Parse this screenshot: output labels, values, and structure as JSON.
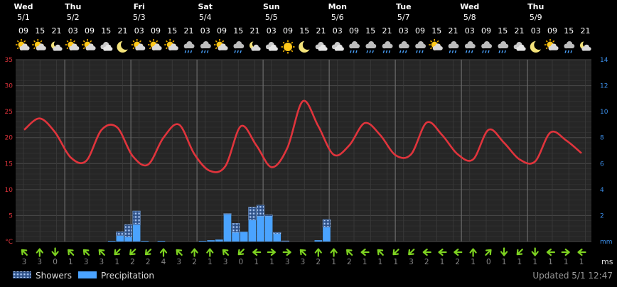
{
  "chart_data": {
    "type": "line",
    "days": [
      {
        "name": "Wed",
        "date": "5/1"
      },
      {
        "name": "Thu",
        "date": "5/2"
      },
      {
        "name": "Fri",
        "date": "5/3"
      },
      {
        "name": "Sat",
        "date": "5/4"
      },
      {
        "name": "Sun",
        "date": "5/5"
      },
      {
        "name": "Mon",
        "date": "5/6"
      },
      {
        "name": "Tue",
        "date": "5/7"
      },
      {
        "name": "Wed",
        "date": "5/8"
      },
      {
        "name": "Thu",
        "date": "5/9"
      }
    ],
    "hours": [
      "09",
      "15",
      "21",
      "03",
      "09",
      "15",
      "21",
      "03",
      "09",
      "15",
      "21",
      "03",
      "09",
      "15",
      "21",
      "03",
      "09",
      "15",
      "21",
      "03",
      "09",
      "15",
      "21",
      "03",
      "09",
      "15",
      "21",
      "03",
      "09",
      "15",
      "21",
      "03",
      "09",
      "15",
      "21"
    ],
    "weather_icons": [
      "sun-cloud",
      "sun-cloud",
      "moon-cloud",
      "sun-cloud",
      "sun-cloud",
      "cloud",
      "moon",
      "sun-cloud",
      "sun-cloud",
      "sun-cloud",
      "cloud-rain",
      "cloud-rain",
      "sun-cloud",
      "cloud-rain",
      "moon-cloud",
      "cloud",
      "sun",
      "moon",
      "cloud",
      "cloud",
      "cloud-rain",
      "cloud-rain",
      "cloud-rain",
      "cloud-rain",
      "cloud-rain",
      "sun-cloud",
      "cloud-rain",
      "cloud-rain",
      "cloud-rain",
      "cloud-rain",
      "cloud",
      "moon",
      "sun-cloud",
      "cloud-rain",
      "moon-cloud"
    ],
    "temperature": {
      "unit": "°C",
      "ylim": [
        0,
        35
      ],
      "ticks": [
        5,
        10,
        15,
        20,
        25,
        30,
        35
      ],
      "color": "#e0343c",
      "values": [
        21.5,
        23.7,
        21.0,
        16.2,
        15.5,
        21.5,
        22.0,
        16.5,
        14.8,
        20.0,
        22.5,
        16.8,
        13.6,
        14.5,
        22.2,
        18.5,
        14.3,
        18.0,
        27.0,
        22.2,
        16.7,
        18.5,
        22.8,
        20.5,
        16.6,
        16.8,
        22.9,
        20.5,
        16.8,
        15.8,
        21.5,
        19.0,
        15.8,
        15.4,
        21.0,
        19.5,
        17.0
      ]
    },
    "precipitation": {
      "unit": "mm",
      "ylim": [
        0,
        14
      ],
      "ticks": [
        2,
        4,
        6,
        8,
        10,
        12,
        14
      ],
      "precip_color": "#4aa3ff",
      "showers_color": "#7fa9df",
      "precip": [
        0,
        0,
        0,
        0,
        0,
        0,
        0,
        0,
        0,
        0,
        0,
        0.05,
        0.45,
        0.35,
        1.3,
        0.05,
        0,
        0.05,
        0,
        0,
        0,
        0,
        0.05,
        0.1,
        0.15,
        2.1,
        0.7,
        0.75,
        1.65,
        1.95,
        1.95,
        0.6,
        0,
        0,
        0,
        0,
        0.1,
        1.1,
        0
      ],
      "showers": [
        0,
        0,
        0,
        0,
        0,
        0,
        0,
        0,
        0,
        0,
        0,
        0,
        0.3,
        0.95,
        1.05,
        0,
        0,
        0,
        0,
        0,
        0,
        0,
        0,
        0,
        0,
        0.05,
        0.7,
        0,
        1.0,
        0.85,
        0.1,
        0.1,
        0.05,
        0,
        0,
        0,
        0,
        0.6,
        0
      ]
    },
    "wind": {
      "unit": "ms",
      "directions": [
        135,
        180,
        0,
        135,
        135,
        135,
        45,
        45,
        45,
        180,
        135,
        180,
        180,
        135,
        45,
        90,
        270,
        270,
        135,
        180,
        180,
        135,
        90,
        135,
        45,
        45,
        90,
        90,
        90,
        180,
        225,
        0,
        45,
        0,
        90,
        270,
        90
      ],
      "speeds": [
        3,
        3,
        0,
        1,
        3,
        3,
        1,
        2,
        2,
        4,
        3,
        2,
        1,
        3,
        0,
        1,
        1,
        3,
        3,
        2,
        1,
        2,
        1,
        1,
        1,
        3,
        2,
        1,
        2,
        1,
        0,
        1,
        1,
        1,
        1,
        1,
        1
      ]
    },
    "legend": [
      {
        "label": "Showers",
        "key": "showers"
      },
      {
        "label": "Precipitation",
        "key": "precip"
      }
    ]
  },
  "footer": {
    "updated": "Updated 5/1 12:47"
  }
}
